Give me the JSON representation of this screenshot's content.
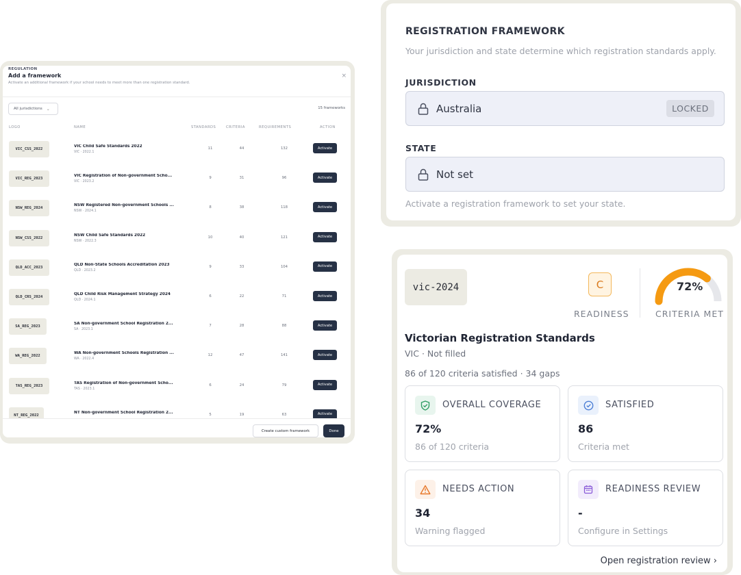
{
  "modal": {
    "eyebrow": "REGULATION",
    "title": "Add a framework",
    "subtitle": "Activate an additional framework if your school needs to meet more than one registration standard.",
    "close_glyph": "×",
    "filter_label": "All jurisdictions",
    "filter_chevron": "⌄",
    "framework_count": "15 frameworks",
    "columns": {
      "logo": "LOGO",
      "name": "NAME",
      "standards": "STANDARDS",
      "criteria": "CRITERIA",
      "requirements": "REQUIREMENTS",
      "action": "ACTION"
    },
    "rows": [
      {
        "code": "VIC_CSS_2022",
        "name": "VIC Child Safe Standards 2022",
        "meta": "VIC · 2022.1",
        "standards": "11",
        "criteria": "44",
        "requirements": "132",
        "action": "Activate"
      },
      {
        "code": "VIC_REG_2023",
        "name": "VIC Registration of Non-government Scho...",
        "meta": "VIC · 2023.2",
        "standards": "9",
        "criteria": "31",
        "requirements": "96",
        "action": "Activate"
      },
      {
        "code": "NSW_REG_2024",
        "name": "NSW Registered Non-government Schools ...",
        "meta": "NSW · 2024.1",
        "standards": "8",
        "criteria": "38",
        "requirements": "118",
        "action": "Activate"
      },
      {
        "code": "NSW_CSS_2022",
        "name": "NSW Child Safe Standards 2022",
        "meta": "NSW · 2022.3",
        "standards": "10",
        "criteria": "40",
        "requirements": "121",
        "action": "Activate"
      },
      {
        "code": "QLD_ACC_2023",
        "name": "QLD Non-State Schools Accreditation 2023",
        "meta": "QLD · 2023.2",
        "standards": "9",
        "criteria": "33",
        "requirements": "104",
        "action": "Activate"
      },
      {
        "code": "QLD_CRS_2024",
        "name": "QLD Child Risk Management Strategy 2024",
        "meta": "QLD · 2024.1",
        "standards": "6",
        "criteria": "22",
        "requirements": "71",
        "action": "Activate"
      },
      {
        "code": "SA_REG_2023",
        "name": "SA Non-government School Registration 2...",
        "meta": "SA · 2023.1",
        "standards": "7",
        "criteria": "28",
        "requirements": "88",
        "action": "Activate"
      },
      {
        "code": "WA_REG_2022",
        "name": "WA Non-government Schools Registration ...",
        "meta": "WA · 2022.4",
        "standards": "12",
        "criteria": "47",
        "requirements": "141",
        "action": "Activate"
      },
      {
        "code": "TAS_REG_2023",
        "name": "TAS Registration of Non-government Scho...",
        "meta": "TAS · 2023.1",
        "standards": "6",
        "criteria": "24",
        "requirements": "79",
        "action": "Activate"
      },
      {
        "code": "NT_REG_2022",
        "name": "NT Non-government School Registration 2...",
        "meta": "",
        "standards": "5",
        "criteria": "19",
        "requirements": "63",
        "action": "Activate"
      }
    ],
    "custom_button": "Create custom framework",
    "done_button": "Done"
  },
  "registration": {
    "title": "REGISTRATION FRAMEWORK",
    "subtitle": "Your jurisdiction and state determine which registration standards apply.",
    "jurisdiction_label": "JURISDICTION",
    "jurisdiction_value": "Australia",
    "locked_badge": "LOCKED",
    "state_label": "STATE",
    "state_value": "Not set",
    "note": "Activate a registration framework to set your state."
  },
  "readiness": {
    "code": "vic-2024",
    "grade": "C",
    "readiness_label": "READINESS",
    "criteria_met_pct": 72,
    "criteria_met_text": "72%",
    "criteria_met_label": "CRITERIA MET",
    "title": "Victorian Registration Standards",
    "subtitle": "VIC · Not filled",
    "summary": "86 of 120 criteria satisfied · 34 gaps",
    "stats": {
      "coverage": {
        "label": "OVERALL COVERAGE",
        "value": "72%",
        "foot": "86 of 120 criteria"
      },
      "satisfied": {
        "label": "SATISFIED",
        "value": "86",
        "foot": "Criteria met"
      },
      "needs_action": {
        "label": "NEEDS ACTION",
        "value": "34",
        "foot": "Warning flagged"
      },
      "review": {
        "label": "READINESS REVIEW",
        "value": "-",
        "foot": "Configure in Settings"
      }
    },
    "open_link": "Open registration review ›"
  },
  "colors": {
    "navy": "#263145",
    "gauge_orange": "#f59a12",
    "gauge_track": "#e6e7eb",
    "green_icon": "#2f9e63",
    "blue_icon": "#4d7fd6",
    "orange_icon": "#e8782a",
    "purple_icon": "#8a5bd8"
  }
}
